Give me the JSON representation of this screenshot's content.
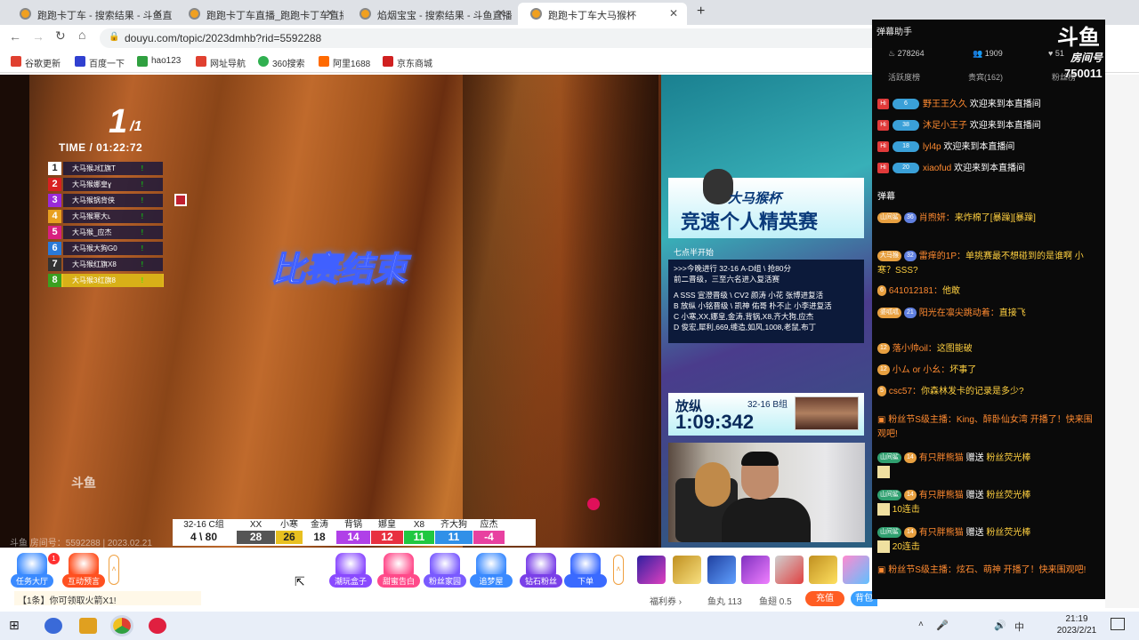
{
  "browser": {
    "tabs": [
      {
        "label": "跑跑卡丁车 - 搜索结果 - 斗鱼直播"
      },
      {
        "label": "跑跑卡丁车直播_跑跑卡丁车直播"
      },
      {
        "label": "焰烟宝宝 - 搜索结果 - 斗鱼直播"
      },
      {
        "label": "跑跑卡丁车大马猴杯"
      }
    ],
    "url": "douyu.com/topic/2023dmhb?rid=5592288",
    "bookmarks": [
      "谷歌更新",
      "百度一下",
      "hao123",
      "网址导航",
      "360搜索",
      "阿里1688",
      "京东商城"
    ]
  },
  "video": {
    "rank": "1",
    "rank_total": "/1",
    "time": "TIME / 01:22:72",
    "ranking": [
      {
        "n": "1",
        "name": "大马猴J红旗T",
        "color": "#ffffff"
      },
      {
        "n": "2",
        "name": "大马猴娜皇ɣ",
        "color": "#d82020"
      },
      {
        "n": "3",
        "name": "大马猴锅背侠",
        "color": "#9a2ad8"
      },
      {
        "n": "4",
        "name": "大马猴寒大ʟ",
        "color": "#e8a020"
      },
      {
        "n": "5",
        "name": "大马猴_应杰",
        "color": "#d82080"
      },
      {
        "n": "6",
        "name": "大马猴大狗G0",
        "color": "#2a7ad8"
      },
      {
        "n": "7",
        "name": "大马猴红旗X8",
        "color": "#333333"
      },
      {
        "n": "8",
        "name": "大马猴3红旗8",
        "color": "#3aa020"
      }
    ],
    "banner": "比赛结束",
    "logo": "斗鱼",
    "watermark": "斗鱼 房间号：5592288 | 2023.02.21",
    "score": {
      "group_label": "32-16 C组",
      "group_value": "4 \\ 80",
      "players": [
        {
          "name": "XX",
          "score": "28",
          "color": "#555555"
        },
        {
          "name": "小寒",
          "score": "26",
          "color": "#e8c020"
        },
        {
          "name": "金涛",
          "score": "18",
          "color": "#ffffff"
        },
        {
          "name": "背锅",
          "score": "14",
          "color": "#b040e8"
        },
        {
          "name": "娜皇",
          "score": "12",
          "color": "#e83040"
        },
        {
          "name": "X8",
          "score": "11",
          "color": "#20c840"
        },
        {
          "name": "齐大狗",
          "score": "11",
          "color": "#3090e8"
        },
        {
          "name": "应杰",
          "score": "-4",
          "color": "#e840a0"
        }
      ]
    }
  },
  "promo": {
    "sub": "大马猴杯",
    "title": "竞速个人精英赛",
    "schedule_head": "七点半开始",
    "schedule": [
      ">>>今晚进行 32-16 A-D组 \\ 抢80分",
      "前二晋级，三至六名进入复活赛",
      "A SSS 宣澄晋级 \\ CV2 颜涛 小花 张博进复活",
      "B 放纵 小铭晋级 \\ 凯神 佑哥 朴不止 小李进复活",
      "C 小寒,XX,娜皇,金涛,背锅,X8,齐大狗,应杰",
      "D 俊宏,犀利,669,缠造,如风,1008,老鼠,布丁"
    ],
    "timer_name": "放纵",
    "timer_group": "32-16 B组",
    "timer_value": "1:09:342"
  },
  "toolbar": {
    "tools": [
      {
        "label": "任务大厅",
        "color": "#3a8aff"
      },
      {
        "label": "互动预言",
        "color": "#ff5020"
      },
      {
        "label": "潮玩盒子",
        "color": "#8a4aff"
      },
      {
        "label": "甜蜜告白",
        "color": "#ff4a8a"
      },
      {
        "label": "粉丝家园",
        "color": "#7a5aff"
      },
      {
        "label": "追梦屋",
        "color": "#3a8aff"
      },
      {
        "label": "钻石粉丝",
        "color": "#7a40e8"
      },
      {
        "label": "下单",
        "color": "#3a6aff"
      }
    ],
    "ticker": "【1条】你可领取火箭X1!",
    "welfare": "福利券 ›",
    "fishball": "鱼丸 113",
    "fishwing": "鱼翅 0.5",
    "recharge": "充值",
    "bag": "背包",
    "task_badge": "1"
  },
  "panel": {
    "title": "弹幕助手",
    "hot": "278264",
    "fans": "1909",
    "x": "51",
    "logo": "斗鱼",
    "room_label": "房间号",
    "room_no": "750011",
    "tabs": [
      "活跃度榜",
      "贵宾(162)",
      "粉丝榜"
    ],
    "welcome": [
      {
        "lv": "6",
        "user": "野王王久久",
        "text": "欢迎来到本直播间"
      },
      {
        "lv": "38",
        "user": "沐足小王子",
        "text": "欢迎来到本直播间"
      },
      {
        "lv": "18",
        "user": "lyl4p",
        "text": "欢迎来到本直播间"
      },
      {
        "lv": "20",
        "user": "xiaofud",
        "text": "欢迎来到本直播间"
      }
    ],
    "section": "弹幕",
    "chat": [
      {
        "badge": "山间鲨",
        "lv": "36",
        "user": "肖煦妍：",
        "text": "来炸棉了[暴躁][暴躁]"
      },
      {
        "badge": "大马猴",
        "lv": "32",
        "user": "雷痒的1P：",
        "text": "单挑赛最不想碰到的是谁啊 小寒？SSS?"
      },
      {
        "badge": "6",
        "lv": "",
        "user": "641012181：",
        "text": "他敢"
      },
      {
        "badge": "婆呱呱",
        "lv": "21",
        "user": "阳光在凛尖跳动着：",
        "text": "直接飞"
      },
      {
        "badge": "12",
        "lv": "",
        "user": "落小帅oil：",
        "text": "这图能破"
      },
      {
        "badge": "12",
        "lv": "",
        "user": "小ム or 小幺：",
        "text": "坏事了"
      },
      {
        "badge": "5",
        "lv": "",
        "user": "csc57：",
        "text": "你森林发卡的记录是多少?"
      }
    ],
    "sys1": "粉丝节S级主播：King、醉卧仙女湾 开播了！快来围观吧!",
    "gifts": [
      {
        "user": "有只胖熊猫",
        "text": "赠送",
        "gift": "粉丝荧光棒",
        "combo": ""
      },
      {
        "user": "有只胖熊猫",
        "text": "赠送",
        "gift": "粉丝荧光棒",
        "combo": "10连击"
      },
      {
        "user": "有只胖熊猫",
        "text": "赠送",
        "gift": "粉丝荧光棒",
        "combo": "20连击"
      }
    ],
    "sys2": "粉丝节S级主播：炫石、萌神 开播了！快来围观吧!"
  },
  "taskbar": {
    "time": "21:19",
    "date": "2023/2/21",
    "ime": "中"
  }
}
